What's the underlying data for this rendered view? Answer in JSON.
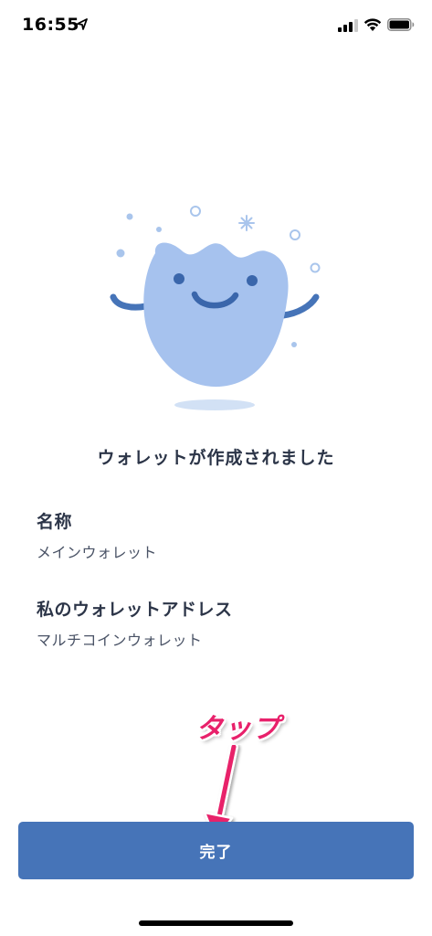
{
  "status_bar": {
    "time": "16:55"
  },
  "heading": "ウォレットが作成されました",
  "name_field": {
    "label": "名称",
    "value": "メインウォレット"
  },
  "address_field": {
    "label": "私のウォレットアドレス",
    "value": "マルチコインウォレット"
  },
  "annotation": {
    "text": "タップ",
    "color": "#e8216b"
  },
  "done_button": {
    "label": "完了",
    "color": "#4674b8"
  }
}
